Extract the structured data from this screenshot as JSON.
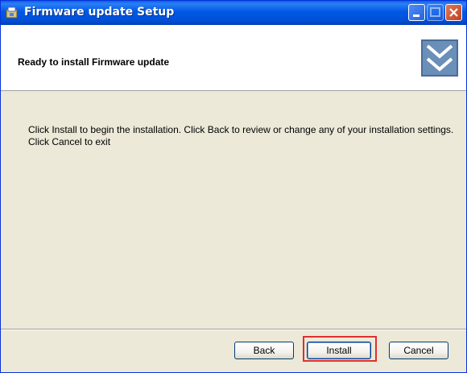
{
  "window": {
    "title": "Firmware update Setup",
    "app_icon": "installer-icon"
  },
  "header": {
    "title": "Ready to install Firmware update",
    "logo_icon": "double-chevron-down-icon"
  },
  "main": {
    "message": "Click Install to begin the installation. Click Back to review or change any of your installation settings. Click Cancel to exit"
  },
  "buttons": {
    "back_label": "Back",
    "install_label": "Install",
    "cancel_label": "Cancel"
  },
  "colors": {
    "titlebar": "#0058e6",
    "focus_highlight": "#e03030",
    "dialog_bg": "#ece9d8"
  }
}
